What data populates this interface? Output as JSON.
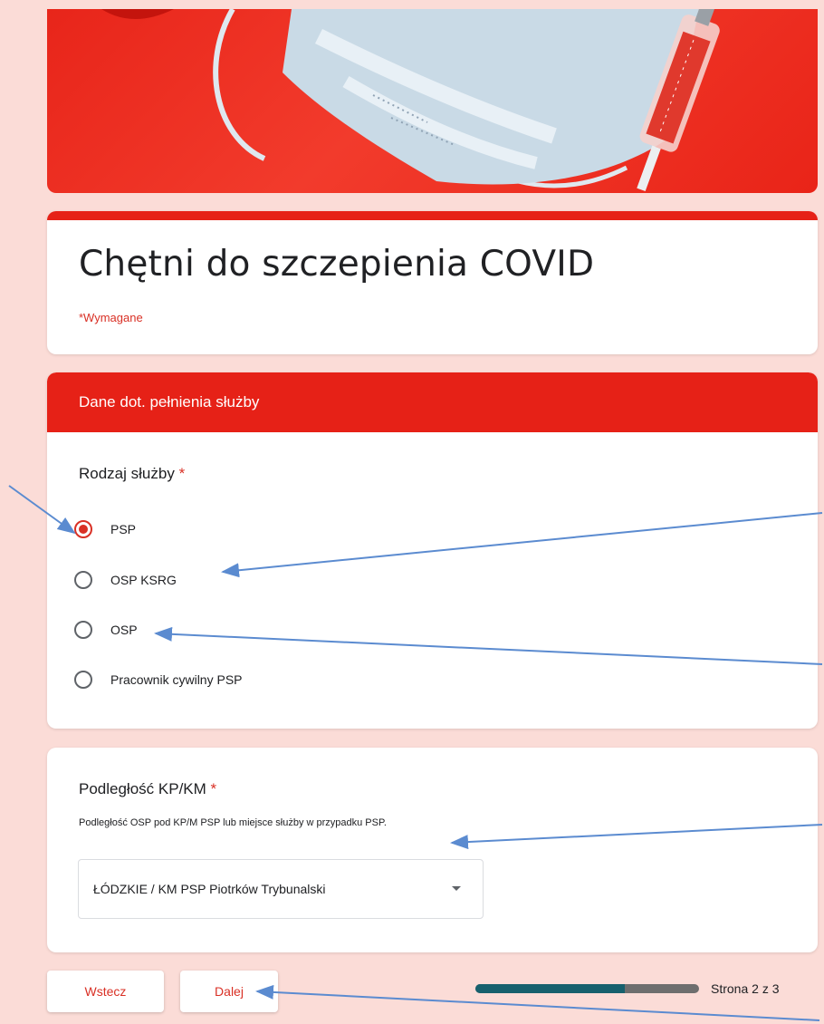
{
  "form": {
    "title": "Chętni do szczepienia COVID",
    "required_note": "*Wymagane",
    "accent_color": "#e62117",
    "background_color": "#fbdcd7"
  },
  "section": {
    "header": "Dane dot. pełnienia służby",
    "question": {
      "title": "Rodzaj służby",
      "required_marker": "*",
      "options": [
        {
          "label": "PSP",
          "selected": true
        },
        {
          "label": "OSP KSRG",
          "selected": false
        },
        {
          "label": "OSP",
          "selected": false
        },
        {
          "label": "Pracownik cywilny PSP",
          "selected": false
        }
      ]
    }
  },
  "subordination": {
    "title": "Podległość KP/KM",
    "required_marker": "*",
    "helper": "Podległość OSP pod KP/M PSP lub miejsce służby w przypadku PSP.",
    "selected_value": "ŁÓDZKIE / KM PSP Piotrków Trybunalski"
  },
  "footer": {
    "back_label": "Wstecz",
    "next_label": "Dalej",
    "page_label": "Strona 2 z 3",
    "progress_fraction": 0.6667
  },
  "icons": {
    "dropdown": "chevron-down-icon",
    "annotation": "arrow-icon"
  }
}
